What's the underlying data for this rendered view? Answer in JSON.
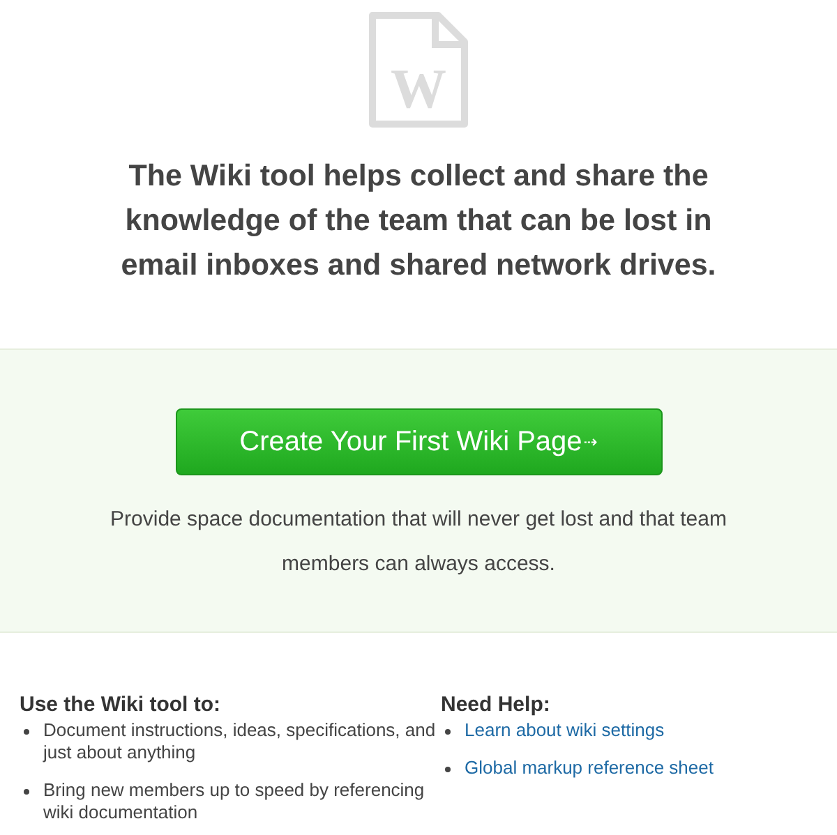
{
  "icon_letter": "W",
  "intro": "The Wiki tool helps collect and share the knowledge of the team that can be lost in email inboxes and shared network drives.",
  "cta": {
    "label": "Create Your First Wiki Page",
    "arrow": "⇢"
  },
  "cta_note": "Provide space documentation that will never get lost and that team members can always access.",
  "uses": {
    "title": "Use the Wiki tool to:",
    "items": [
      "Document instructions, ideas, specifications, and just about anything",
      "Bring new members up to speed by referencing wiki documentation"
    ]
  },
  "help": {
    "title": "Need Help:",
    "links": [
      "Learn about wiki settings",
      "Global markup reference sheet"
    ]
  }
}
